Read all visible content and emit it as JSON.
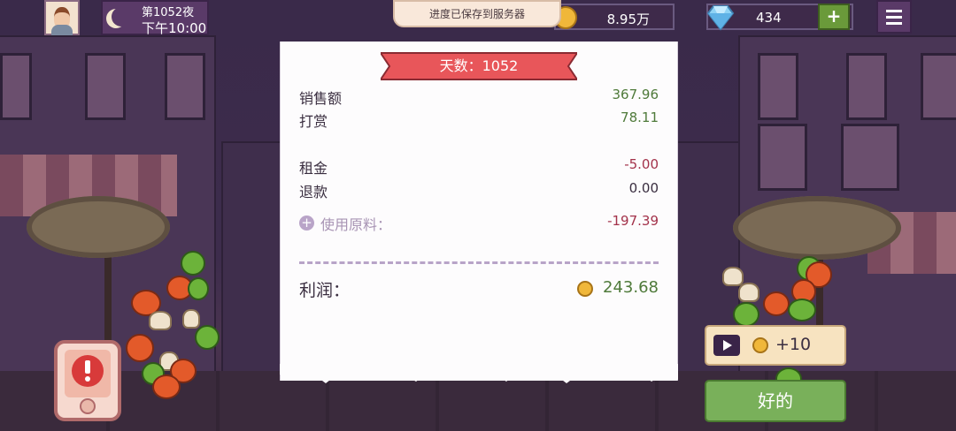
{
  "hud": {
    "day_night_label": "第1052夜",
    "clock": "下午10:00",
    "save_toast": "进度已保存到服务器",
    "coins": "8.95万",
    "gems": "434",
    "gem_add_label": "+"
  },
  "receipt": {
    "ribbon": "天数：1052",
    "rows": [
      {
        "label": "销售额",
        "value": "367.96"
      },
      {
        "label": "打赏",
        "value": "78.11"
      },
      {
        "label": "租金",
        "value": "-5.00"
      },
      {
        "label": "退款",
        "value": "0.00"
      },
      {
        "label": "使用原料：",
        "value": "-197.39"
      }
    ],
    "expand_symbol": "+",
    "profit_label": "利润：",
    "profit_value": "243.68"
  },
  "actions": {
    "ad_reward": "+10",
    "ok": "好的"
  },
  "colors": {
    "positive": "#4f7a3a",
    "negative": "#a3324a",
    "ribbon": "#e8565a",
    "ok_button": "#79b05a"
  }
}
